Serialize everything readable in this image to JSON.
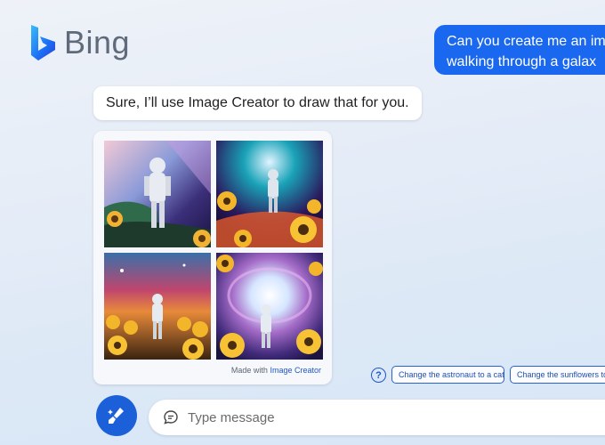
{
  "app": {
    "logo_text": "Bing"
  },
  "conversation": {
    "user_message_line1": "Can you create me an im",
    "user_message_line2": "walking through a galax",
    "bot_message": "Sure, I’ll use Image Creator to draw that for you."
  },
  "image_card": {
    "made_with_prefix": "Made with",
    "made_with_link": "Image Creator",
    "images": [
      "generated-image-1",
      "generated-image-2",
      "generated-image-3",
      "generated-image-4"
    ]
  },
  "suggestions": {
    "help_icon": "?",
    "chips": [
      "Change the astronaut to a cat",
      "Change the sunflowers to"
    ]
  },
  "composer": {
    "placeholder": "Type message",
    "new_topic_icon": "broom-sparkle-icon",
    "chat_icon": "chat-bubble-icon"
  },
  "colors": {
    "accent": "#1b68f0",
    "link": "#1f56c8"
  }
}
